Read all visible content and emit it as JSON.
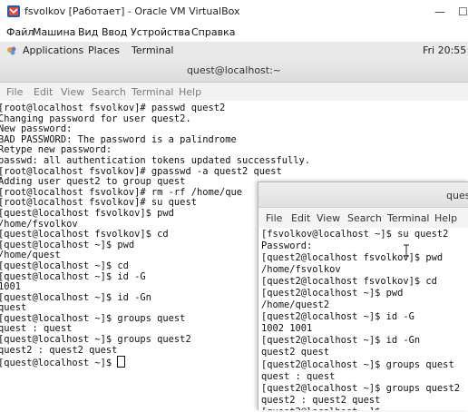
{
  "vbox": {
    "title": "fsvolkov [Работает] - Oracle VM VirtualBox",
    "menu": [
      "Файл",
      "Машина",
      "Вид",
      "Ввод",
      "Устройства",
      "Справка"
    ]
  },
  "panel": {
    "applications": "Applications",
    "places": "Places",
    "terminal": "Terminal",
    "clock": "Fri 20:55"
  },
  "terminal1": {
    "title": "quest@localhost:~",
    "menu": [
      "File",
      "Edit",
      "View",
      "Search",
      "Terminal",
      "Help"
    ],
    "lines": [
      "[root@localhost fsvolkov]# passwd quest2",
      "Changing password for user quest2.",
      "New password:",
      "BAD PASSWORD: The password is a palindrome",
      "Retype new password:",
      "passwd: all authentication tokens updated successfully.",
      "[root@localhost fsvolkov]# gpasswd -a quest2 quest",
      "Adding user quest2 to group quest",
      "[root@localhost fsvolkov]# rm -rf /home/que",
      "[root@localhost fsvolkov]# su quest",
      "[quest@localhost fsvolkov]$ pwd",
      "/home/fsvolkov",
      "[quest@localhost fsvolkov]$ cd",
      "[quest@localhost ~]$ pwd",
      "/home/quest",
      "[quest@localhost ~]$ cd",
      "[quest@localhost ~]$ id -G",
      "1001",
      "[quest@localhost ~]$ id -Gn",
      "quest",
      "[quest@localhost ~]$ groups quest",
      "quest : quest",
      "[quest@localhost ~]$ groups quest2",
      "quest2 : quest2 quest",
      "[quest@localhost ~]$ "
    ]
  },
  "terminal2": {
    "title": "ques",
    "menu": [
      "File",
      "Edit",
      "View",
      "Search",
      "Terminal",
      "Help"
    ],
    "lines": [
      "[fsvolkov@localhost ~]$ su quest2",
      "Password:",
      "[quest2@localhost fsvolkov]$ pwd",
      "/home/fsvolkov",
      "[quest2@localhost fsvolkov]$ cd",
      "[quest2@localhost ~]$ pwd",
      "/home/quest2",
      "[quest2@localhost ~]$ id -G",
      "1002 1001",
      "[quest2@localhost ~]$ id -Gn",
      "quest2 quest",
      "[quest2@localhost ~]$ groups quest",
      "quest : quest",
      "[quest2@localhost ~]$ groups quest2",
      "quest2 : quest2 quest",
      "[quest2@localhost ~]$ "
    ]
  }
}
